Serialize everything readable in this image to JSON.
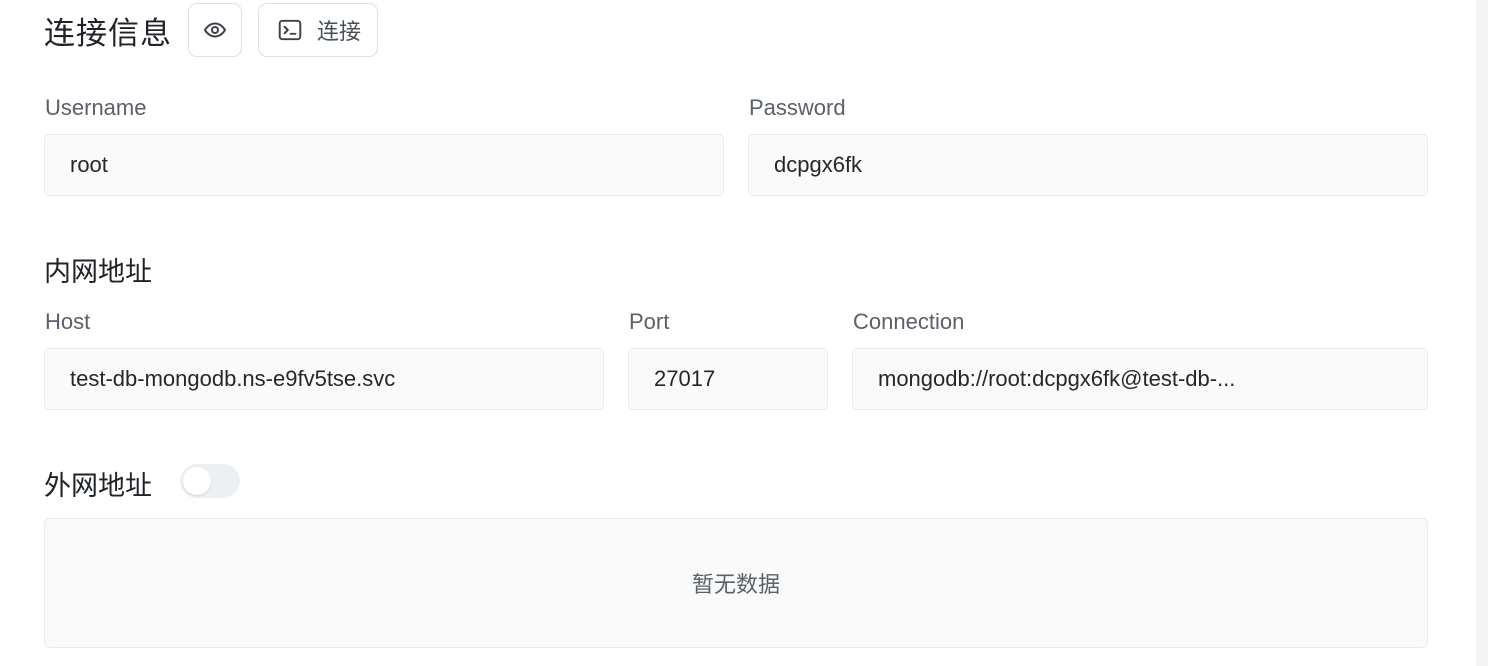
{
  "header": {
    "title": "连接信息",
    "eye_icon": "eye-icon",
    "connect_icon": "terminal-icon",
    "connect_label": "连接"
  },
  "credentials": {
    "username_label": "Username",
    "username_value": "root",
    "password_label": "Password",
    "password_value": "dcpgx6fk"
  },
  "internal": {
    "title": "内网地址",
    "host_label": "Host",
    "host_value": "test-db-mongodb.ns-e9fv5tse.svc",
    "port_label": "Port",
    "port_value": "27017",
    "connection_label": "Connection",
    "connection_value": "mongodb://root:dcpgx6fk@test-db-..."
  },
  "external": {
    "title": "外网地址",
    "toggle_on": false,
    "empty_text": "暂无数据"
  },
  "colors": {
    "field_bg": "#fafafa",
    "border": "#e8eaed",
    "label": "#5a6169",
    "text": "#24282c",
    "toggle_off": "#edf0f3"
  }
}
